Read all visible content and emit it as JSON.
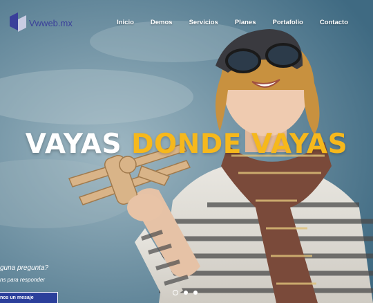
{
  "brand": {
    "logo_text": "Vwweb.mx"
  },
  "nav": {
    "items": [
      {
        "label": "Inicio"
      },
      {
        "label": "Demos"
      },
      {
        "label": "Servicios"
      },
      {
        "label": "Planes"
      },
      {
        "label": "Portafolio"
      },
      {
        "label": "Contacto"
      }
    ]
  },
  "hero": {
    "headline_white": "VAYAS",
    "headline_yellow": "DONDE VAYAS",
    "accent_color": "#f6b81c"
  },
  "chat": {
    "question": "guna pregunta?",
    "subtext": "ns para responder",
    "button_label": "nos un mesaje",
    "button_color": "#2b3f9b"
  },
  "slider": {
    "slides": 3,
    "active_index": 0
  }
}
